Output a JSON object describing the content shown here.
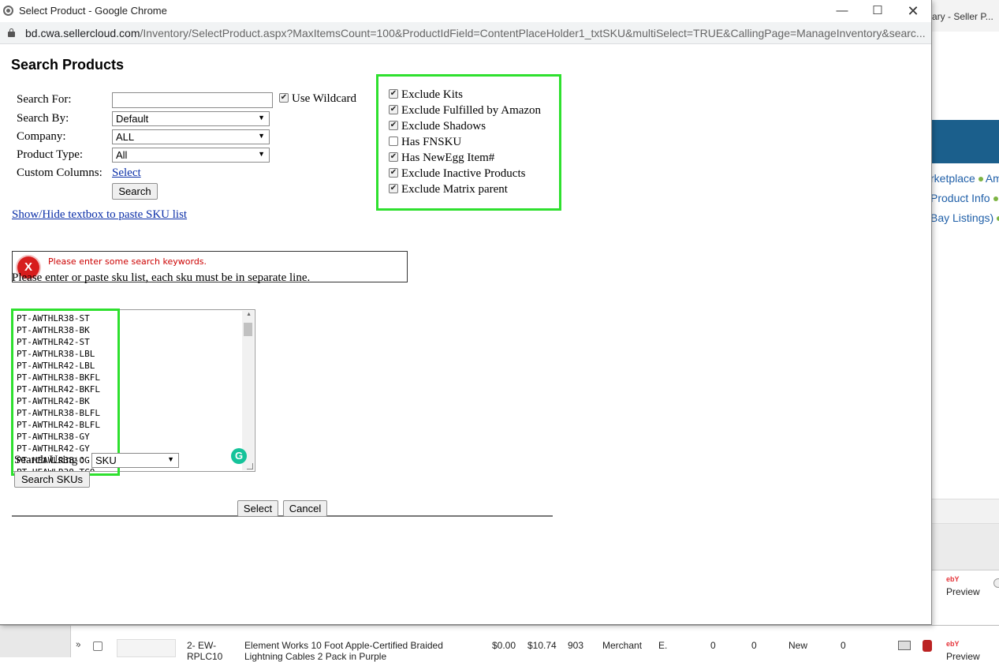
{
  "background_window": {
    "title": "ary - Seller P...",
    "links": [
      "rketplace",
      "Am",
      "Product Info",
      "Bay Listings)"
    ],
    "preview_label": "Preview",
    "ebay_label": "ebY",
    "row": {
      "index_sku": "2- EW-",
      "sku_cont": "RPLC10",
      "product": "Element Works 10 Foot Apple-Certified Braided",
      "product_cont": "Lightning Cables 2 Pack in Purple",
      "price1": "$0.00",
      "price2": "$10.74",
      "qty": "903",
      "fulfillment": "Merchant",
      "code": "E.",
      "n1": "0",
      "n2": "0",
      "condition": "New",
      "n3": "0",
      "preview": "Preview"
    }
  },
  "window": {
    "title": "Select Product - Google Chrome",
    "url_host": "bd.cwa.sellercloud.com",
    "url_path": "/Inventory/SelectProduct.aspx?MaxItemsCount=100&ProductIdField=ContentPlaceHolder1_txtSKU&multiSelect=TRUE&CallingPage=ManageInventory&searc..."
  },
  "page": {
    "title": "Search Products",
    "search_for_label": "Search For:",
    "search_for_value": "",
    "use_wildcard_label": "Use Wildcard",
    "search_by_label": "Search By:",
    "search_by_value": "Default",
    "company_label": "Company:",
    "company_value": "ALL",
    "product_type_label": "Product Type:",
    "product_type_value": "All",
    "custom_columns_label": "Custom Columns:",
    "custom_columns_link": "Select",
    "search_button": "Search",
    "options": [
      {
        "label": "Exclude Kits",
        "checked": true
      },
      {
        "label": "Exclude Fulfilled by Amazon",
        "checked": true
      },
      {
        "label": "Exclude Shadows",
        "checked": true
      },
      {
        "label": "Has FNSKU",
        "checked": false
      },
      {
        "label": "Has NewEgg Item#",
        "checked": true
      },
      {
        "label": "Exclude Inactive Products",
        "checked": true
      },
      {
        "label": "Exclude Matrix parent",
        "checked": true
      }
    ],
    "toggle_link": "Show/Hide textbox to paste SKU list",
    "error_message": "Please enter some search keywords.",
    "sku_instructions": "Please enter or paste sku list, each sku must be in separate line.",
    "sku_list": [
      "PT-AWTHLR38-ST",
      "PT-AWTHLR38-BK",
      "PT-AWTHLR42-ST",
      "PT-AWTHLR38-LBL",
      "PT-AWTHLR42-LBL",
      "PT-AWTHLR38-BKFL",
      "PT-AWTHLR42-BKFL",
      "PT-AWTHLR42-BK",
      "PT-AWTHLR38-BLFL",
      "PT-AWTHLR42-BLFL",
      "PT-AWTHLR38-GY",
      "PT-AWTHLR42-GY",
      "PT-HEAWLR38-OG",
      "PT-HEAWLR38-TCO"
    ],
    "search_using_label": "Search Using :",
    "search_using_value": "SKU",
    "search_skus_button": "Search SKUs",
    "select_button": "Select",
    "cancel_button": "Cancel"
  },
  "colors": {
    "highlight": "#2ee02e",
    "error_red": "#d71d1d",
    "link_blue": "#0b2fa8",
    "bg_blue": "#1b5f8c"
  }
}
